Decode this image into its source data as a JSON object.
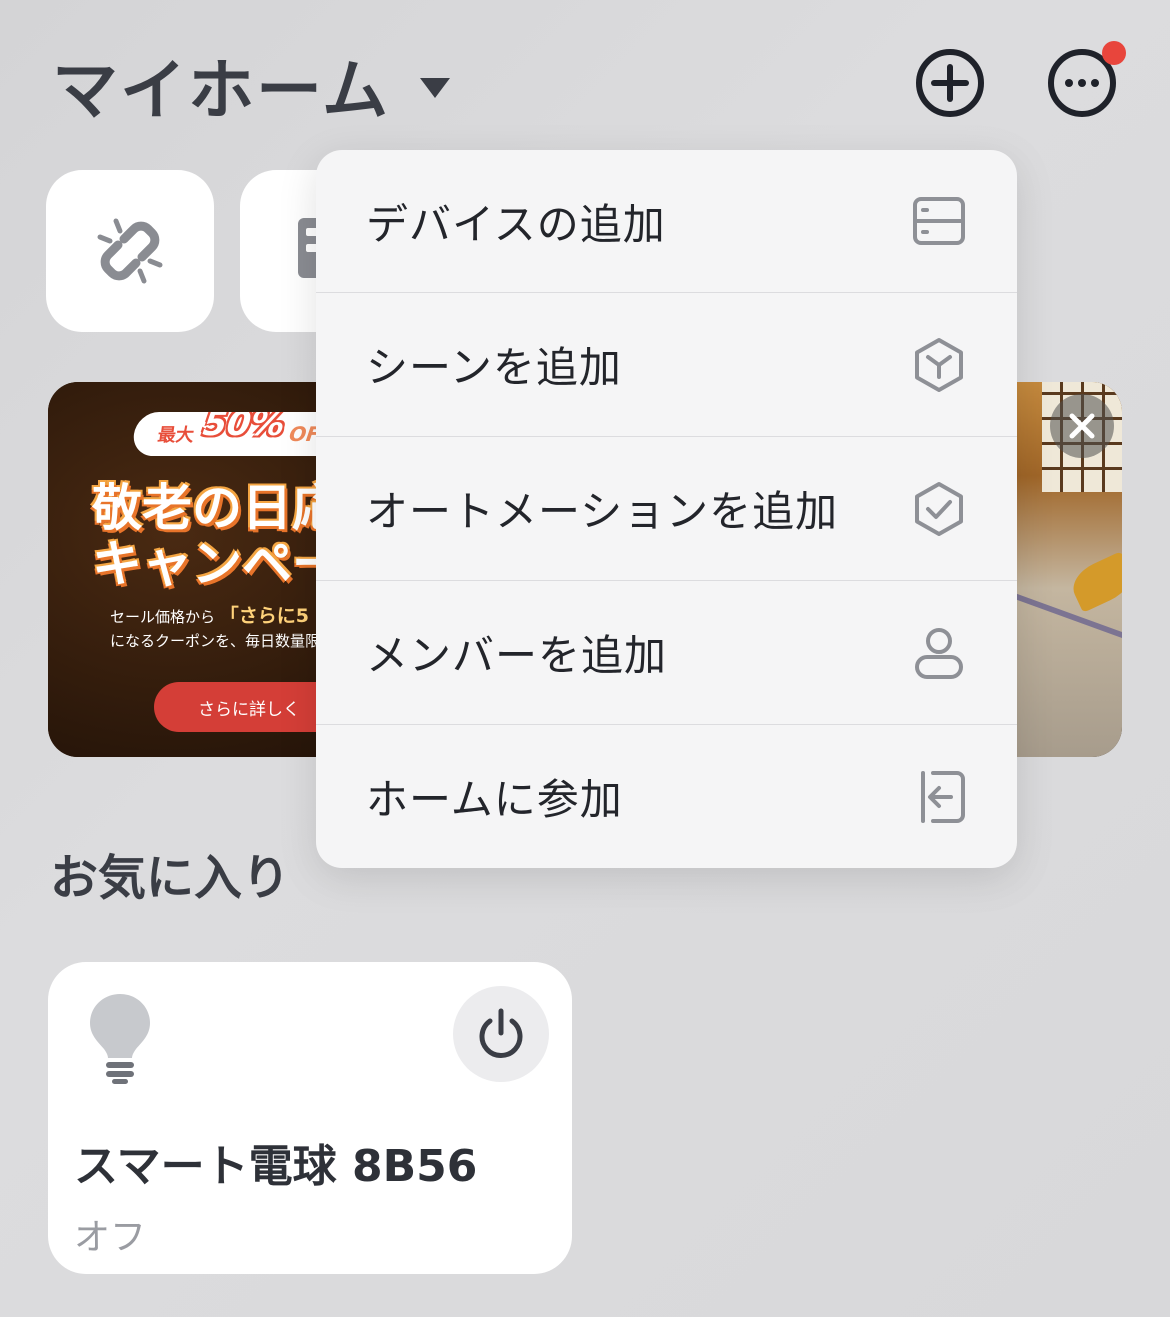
{
  "header": {
    "home_title": "マイホーム",
    "add_icon": "plus-circle-icon",
    "more_icon": "ellipsis-circle-icon",
    "notification_dot_color": "#e8453c"
  },
  "shortcuts": [
    {
      "icon": "unlink-icon"
    },
    {
      "icon": "device-icon"
    }
  ],
  "banner": {
    "badge_prefix": "最大",
    "badge_percent": "50%",
    "badge_suffix": "OF",
    "title_line1": "敬老の日応",
    "title_line2": "キャンペー",
    "desc_line1_prefix": "セール価格から",
    "desc_line1_highlight": "「さらに5",
    "desc_line2": "になるクーポンを、毎日数量限",
    "cta_label": "さらに詳しく",
    "close_icon": "close-icon"
  },
  "favorites": {
    "title": "お気に入り",
    "device": {
      "name": "スマート電球 8B56",
      "status": "オフ",
      "icon": "bulb-icon",
      "power_icon": "power-icon"
    }
  },
  "menu": {
    "items": [
      {
        "label": "デバイスの追加",
        "icon": "device-panel-icon"
      },
      {
        "label": "シーンを追加",
        "icon": "scene-hexagon-icon"
      },
      {
        "label": "オートメーションを追加",
        "icon": "automation-check-icon"
      },
      {
        "label": "メンバーを追加",
        "icon": "member-icon"
      },
      {
        "label": "ホームに参加",
        "icon": "join-home-icon"
      }
    ]
  }
}
